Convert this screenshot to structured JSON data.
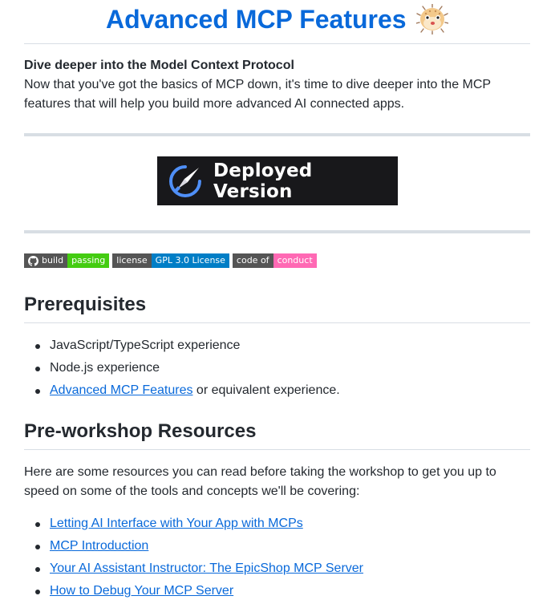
{
  "header": {
    "title": "Advanced MCP Features",
    "emoji_icon": "puffer-fish-icon"
  },
  "intro": {
    "lead": "Dive deeper into the Model Context Protocol",
    "body": "Now that you've got the basics of MCP down, it's time to dive deeper into the MCP features that will help you build more advanced AI connected apps."
  },
  "deploy_banner": {
    "label": "Deployed Version",
    "icon": "rocket-icon",
    "background": "#18181b"
  },
  "badges": [
    {
      "label": "build",
      "message": "passing",
      "color": "#44cc11",
      "icon": "github-icon"
    },
    {
      "label": "license",
      "message": "GPL 3.0 License",
      "color": "#007ec6"
    },
    {
      "label": "code of",
      "message": "conduct",
      "color": "#ff69b4"
    }
  ],
  "prerequisites": {
    "heading": "Prerequisites",
    "items": [
      {
        "text": "JavaScript/TypeScript experience"
      },
      {
        "text": "Node.js experience"
      },
      {
        "link": "Advanced MCP Features",
        "text": " or equivalent experience."
      }
    ]
  },
  "resources": {
    "heading": "Pre-workshop Resources",
    "intro": "Here are some resources you can read before taking the workshop to get you up to speed on some of the tools and concepts we'll be covering:",
    "links": [
      "Letting AI Interface with Your App with MCPs",
      "MCP Introduction",
      "Your AI Assistant Instructor: The EpicShop MCP Server",
      "How to Debug Your MCP Server"
    ]
  },
  "colors": {
    "link": "#0969da",
    "text": "#24292f",
    "rule": "#d8dee4"
  }
}
